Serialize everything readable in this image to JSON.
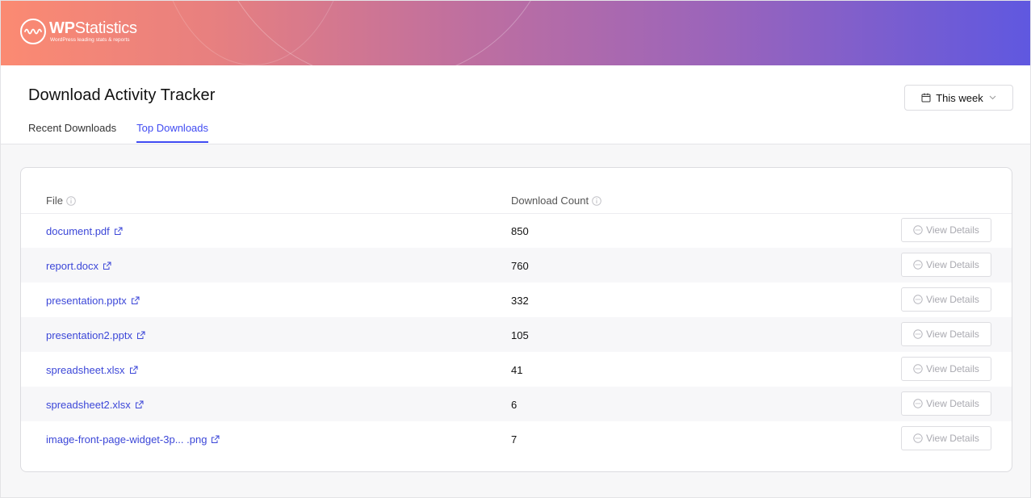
{
  "brand": {
    "name_bold": "WP",
    "name_rest": "Statistics",
    "tagline": "WordPress leading stats & reports"
  },
  "page": {
    "title": "Download Activity Tracker",
    "tabs": [
      {
        "label": "Recent Downloads",
        "active": false
      },
      {
        "label": "Top Downloads",
        "active": true
      }
    ],
    "date_filter": {
      "label": "This week",
      "icon": "calendar-icon"
    }
  },
  "table": {
    "columns": [
      {
        "label": "File",
        "icon": "info-icon"
      },
      {
        "label": "Download Count",
        "icon": "info-icon"
      }
    ],
    "action_label": "View Details",
    "rows": [
      {
        "file": "document.pdf",
        "count": "850"
      },
      {
        "file": "report.docx",
        "count": "760"
      },
      {
        "file": "presentation.pptx",
        "count": "332"
      },
      {
        "file": "presentation2.pptx",
        "count": "105"
      },
      {
        "file": "spreadsheet.xlsx",
        "count": "41"
      },
      {
        "file": "spreadsheet2.xlsx",
        "count": "6"
      },
      {
        "file": "image-front-page-widget-3p... .png",
        "count": "7"
      }
    ]
  },
  "colors": {
    "accent": "#404bf2",
    "link": "#3c47d8",
    "banner_start": "#fb8a72",
    "banner_end": "#5f58e0"
  }
}
